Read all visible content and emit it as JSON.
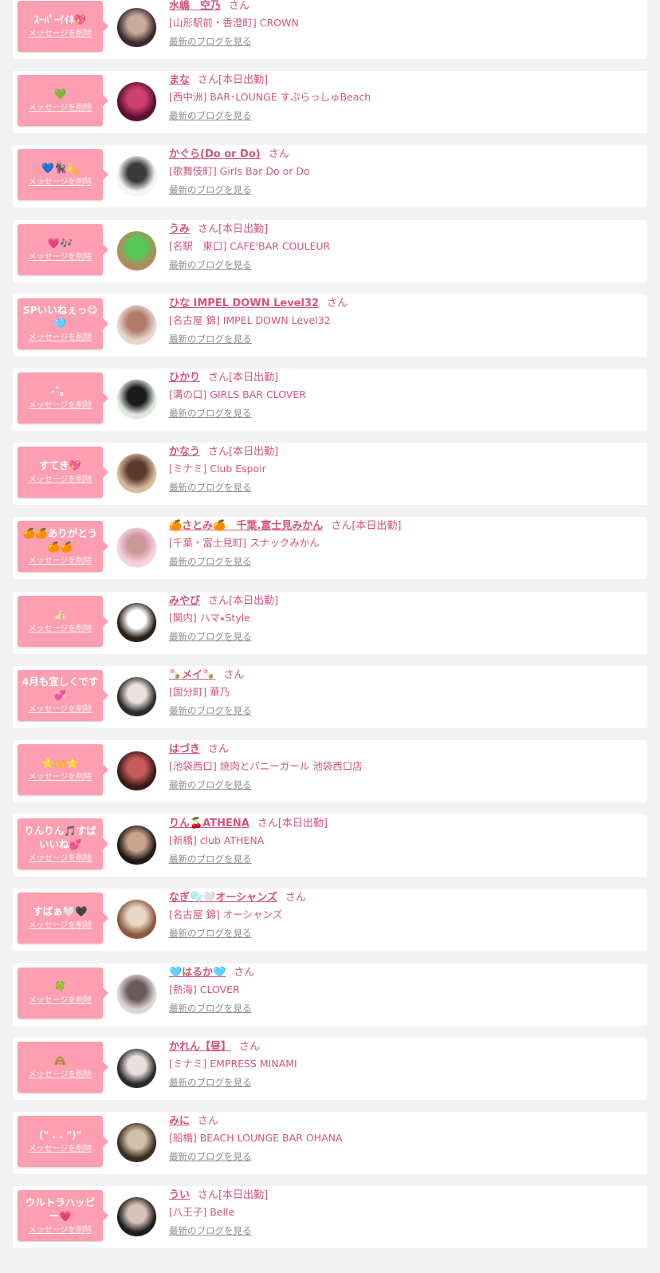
{
  "delete_label": "メッセージを削除",
  "blog_label": "最新のブログを見る",
  "san_label": "さん",
  "colors": {
    "bubble": "#fd9fb1",
    "name": "#d2557a",
    "link_gray": "#8d8d8d",
    "background": "#f2f2f2"
  },
  "messages": [
    {
      "message": "ｽｰﾊﾟｰｲｲﾈ💖",
      "name": "水嶋　空乃",
      "status": "",
      "shop": "[山形駅前・香澄町] CROWN",
      "avatar_colors": [
        "#3a2a2a",
        "#c9a99a"
      ]
    },
    {
      "message": "💚",
      "name": "まな",
      "status": "[本日出勤]",
      "shop": "[西中洲] BAR･LOUNGE すぷらっしゅBeach",
      "avatar_colors": [
        "#5a1030",
        "#d04070"
      ]
    },
    {
      "message": "💙🐈‍⬛💫",
      "name": "かぐら(Do or Do)",
      "status": "",
      "shop": "[歌舞伎町] Girls Bar Do or Do",
      "avatar_colors": [
        "#f4f4f4",
        "#3a3a3a"
      ]
    },
    {
      "message": "💗🎶",
      "name": "うみ",
      "status": "[本日出勤]",
      "shop": "[名駅　東口] CAFE'BAR COULEUR",
      "avatar_colors": [
        "#b08a5a",
        "#55c855"
      ]
    },
    {
      "message": "SPいいねぇっ😋🩵",
      "name": "ひな IMPEL DOWN Level32",
      "status": "",
      "shop": "[名古屋 錦] IMPEL DOWN Level32",
      "avatar_colors": [
        "#e8d5cc",
        "#b07a6a"
      ]
    },
    {
      "message": "·˚。",
      "name": "ひかり",
      "status": "[本日出勤]",
      "shop": "[溝の口] GIRLS BAR CLOVER",
      "avatar_colors": [
        "#dfe7df",
        "#1a1a1a"
      ]
    },
    {
      "message": "すてき💖",
      "name": "かなう",
      "status": "[本日出勤]",
      "shop": "[ミナミ] Club Espoir",
      "avatar_colors": [
        "#d9b89c",
        "#5a3a2a"
      ]
    },
    {
      "message": "🍊🍊ありがとう🍊🍊",
      "name": "🍊さとみ🍊　千葉.富士見みかん",
      "status": "[本日出勤]",
      "shop": "[千葉・富士見町] スナックみかん",
      "avatar_colors": [
        "#f6d0e0",
        "#c99"
      ]
    },
    {
      "message": "👍🏻",
      "name": "みやび",
      "status": "[本日出勤]",
      "shop": "[関内] ハマ⭑Style",
      "avatar_colors": [
        "#2a1e18",
        "#ffffff"
      ]
    },
    {
      "message": "4月も宜しくです💞",
      "name": "🍡メイ🍡",
      "status": "",
      "shop": "[国分町] 華乃",
      "avatar_colors": [
        "#2e2a2a",
        "#e9e3de"
      ]
    },
    {
      "message": "⭐️🙌⭐️",
      "name": "はづき",
      "status": "",
      "shop": "[池袋西口] 焼肉とバニーガール 池袋西口店",
      "avatar_colors": [
        "#3a1a1a",
        "#c85a5a"
      ]
    },
    {
      "message": "りんりん🎵すばいいね💕",
      "name": "りん🍒ATHENA",
      "status": "[本日出勤]",
      "shop": "[新橋] club ATHENA",
      "avatar_colors": [
        "#1e1814",
        "#c9a48a"
      ]
    },
    {
      "message": "すばぁ🤍🖤",
      "name": "なぎ🫧🤍オーシャンズ",
      "status": "",
      "shop": "[名古屋 錦] オーシャンズ",
      "avatar_colors": [
        "#8a5a3a",
        "#e9d7c8"
      ]
    },
    {
      "message": "🍀",
      "name": "🩵はるか🩵",
      "status": "",
      "shop": "[熱海] CLOVER",
      "avatar_colors": [
        "#ddd5d5",
        "#6a5a5a"
      ]
    },
    {
      "message": "🙈",
      "name": "かれん【昼】",
      "status": "",
      "shop": "[ミナミ] EMPRESS MINAMI",
      "avatar_colors": [
        "#2a2a2a",
        "#e9e0dc"
      ]
    },
    {
      "message": "(\" . . \")\"",
      "name": "みに",
      "status": "",
      "shop": "[船橋] BEACH LOUNGE BAR OHANA",
      "avatar_colors": [
        "#3a2e24",
        "#d4c0a8"
      ]
    },
    {
      "message": "ウルトラハッピー💗",
      "name": "うい",
      "status": "[本日出勤]",
      "shop": "[八王子] Belle",
      "avatar_colors": [
        "#1c1c1c",
        "#d9c3b8"
      ]
    }
  ]
}
